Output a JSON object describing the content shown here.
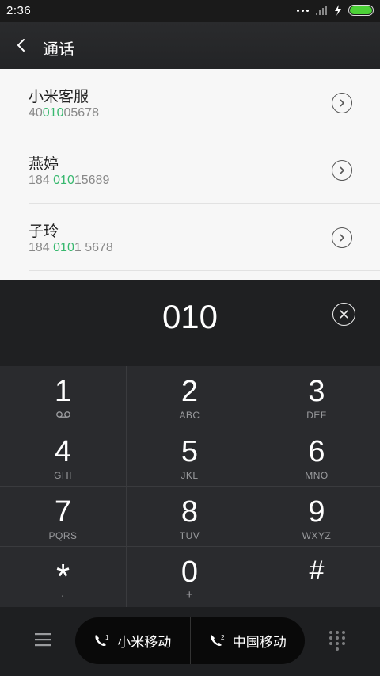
{
  "status_bar": {
    "time": "2:36"
  },
  "app_bar": {
    "title": "通话"
  },
  "contacts": [
    {
      "name": "小米客服",
      "number_pre": "40",
      "number_hl": "010",
      "number_post": "05678"
    },
    {
      "name": "燕婷",
      "number_pre": "184 ",
      "number_hl": "010",
      "number_post": "15689"
    },
    {
      "name": "子玲",
      "number_pre": "184 ",
      "number_hl": "010",
      "number_post": "1 5678"
    }
  ],
  "dial": {
    "number": "010"
  },
  "keypad": [
    {
      "digit": "1",
      "letters": ""
    },
    {
      "digit": "2",
      "letters": "ABC"
    },
    {
      "digit": "3",
      "letters": "DEF"
    },
    {
      "digit": "4",
      "letters": "GHI"
    },
    {
      "digit": "5",
      "letters": "JKL"
    },
    {
      "digit": "6",
      "letters": "MNO"
    },
    {
      "digit": "7",
      "letters": "PQRS"
    },
    {
      "digit": "8",
      "letters": "TUV"
    },
    {
      "digit": "9",
      "letters": "WXYZ"
    },
    {
      "digit": "*",
      "letters": ","
    },
    {
      "digit": "0",
      "letters": "+"
    },
    {
      "digit": "#",
      "letters": ""
    }
  ],
  "bottom_bar": {
    "sim1": {
      "badge": "1",
      "label": "小米移动"
    },
    "sim2": {
      "badge": "2",
      "label": "中国移动"
    }
  },
  "colors": {
    "highlight": "#37b86e",
    "battery": "#4cd137"
  }
}
